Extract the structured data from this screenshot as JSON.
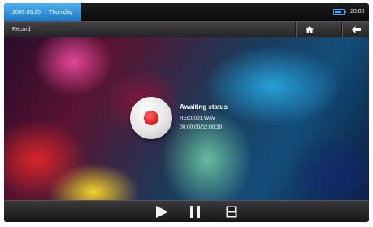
{
  "status_bar": {
    "date": "2009.06.25",
    "weekday": "Thursday",
    "time": "20:00",
    "battery_icon": "battery-icon"
  },
  "title_bar": {
    "title": "Record",
    "home_icon": "home-icon",
    "back_icon": "back-arrow-icon"
  },
  "recorder": {
    "status": "Awaiting status",
    "file_name": "REC0001.WAV",
    "time": "00:00:00/02:00:30",
    "record_icon": "record-icon"
  },
  "controls": {
    "play_icon": "play-icon",
    "pause_icon": "pause-icon",
    "save_icon": "save-icon"
  },
  "colors": {
    "accent": "#2b8fe0",
    "record_red": "#e0201c"
  }
}
